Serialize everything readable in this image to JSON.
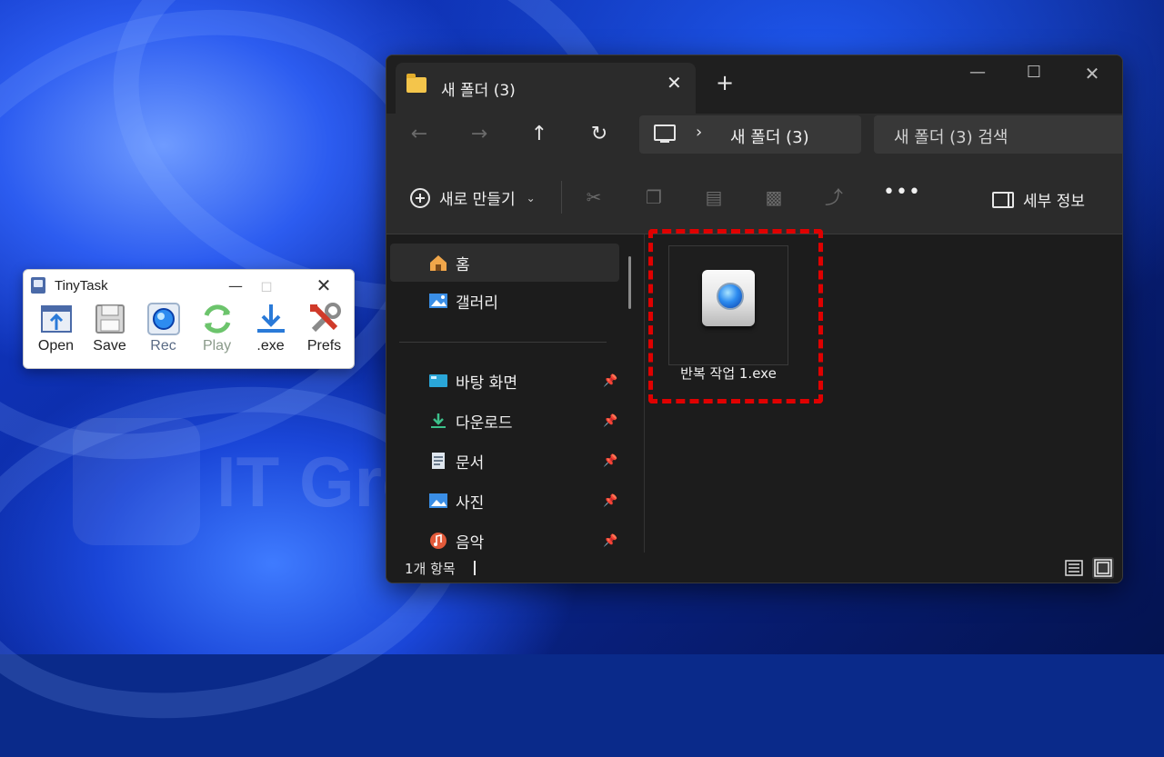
{
  "tinytask": {
    "title": "TinyTask",
    "tools": [
      {
        "label": "Open",
        "icon": "open-icon"
      },
      {
        "label": "Save",
        "icon": "save-icon"
      },
      {
        "label": "Rec",
        "icon": "record-icon"
      },
      {
        "label": "Play",
        "icon": "play-icon"
      },
      {
        "label": ".exe",
        "icon": "compile-exe-icon"
      },
      {
        "label": "Prefs",
        "icon": "prefs-icon"
      }
    ]
  },
  "explorer": {
    "tab": {
      "label": "새 폴더 (3)"
    },
    "address": {
      "current": "새 폴더 (3)"
    },
    "search": {
      "placeholder": "새 폴더 (3) 검색"
    },
    "command_bar": {
      "new_label": "새로 만들기",
      "details_label": "세부 정보"
    },
    "sidebar": {
      "items": [
        {
          "label": "홈",
          "icon": "home-icon",
          "selected": true
        },
        {
          "label": "갤러리",
          "icon": "gallery-icon"
        },
        {
          "label": "바탕 화면",
          "icon": "desktop-icon",
          "pinned": true
        },
        {
          "label": "다운로드",
          "icon": "download-icon",
          "pinned": true
        },
        {
          "label": "문서",
          "icon": "documents-icon",
          "pinned": true
        },
        {
          "label": "사진",
          "icon": "pictures-icon",
          "pinned": true
        },
        {
          "label": "음악",
          "icon": "music-icon",
          "pinned": true
        }
      ]
    },
    "files": [
      {
        "name": "반복 작업 1.exe",
        "icon": "tinytask-exe-icon",
        "highlighted": true
      }
    ],
    "status": {
      "item_count": "1개 항목"
    }
  },
  "watermark": {
    "text": "IT Great King"
  },
  "colors": {
    "highlight": "#e00000",
    "accent": "#2d8cf0"
  }
}
